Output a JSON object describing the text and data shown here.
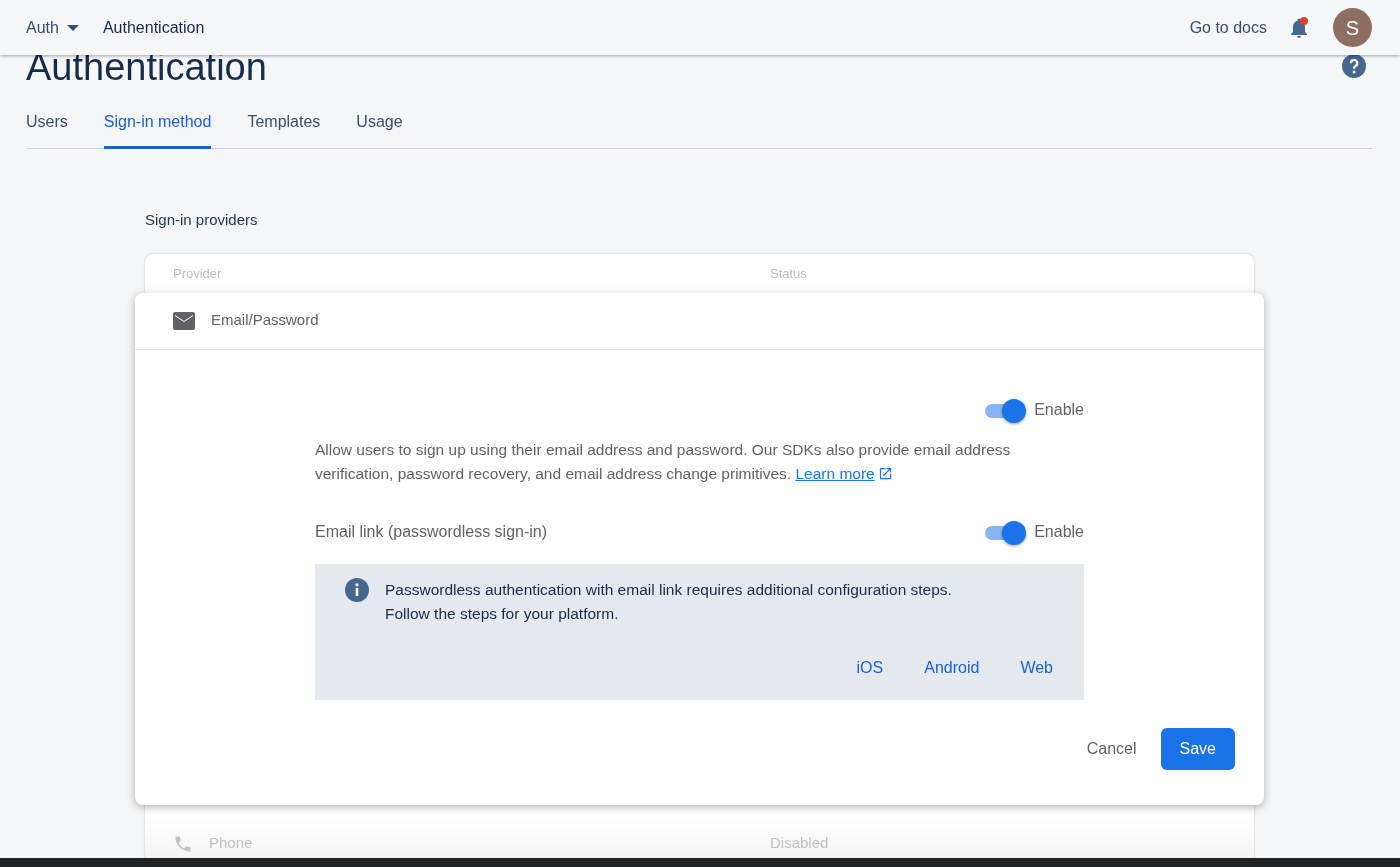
{
  "top_bar": {
    "product": "Auth",
    "page": "Authentication",
    "docs_link": "Go to docs",
    "notifications": {
      "unread": true
    },
    "avatar": "S"
  },
  "page_title": "Authentication",
  "tabs": [
    {
      "label": "Users",
      "selected": false
    },
    {
      "label": "Sign-in method",
      "selected": true
    },
    {
      "label": "Templates",
      "selected": false
    },
    {
      "label": "Usage",
      "selected": false
    }
  ],
  "section_title": "Sign-in providers",
  "table": {
    "columns": [
      "Provider",
      "Status"
    ],
    "expanded_provider": {
      "name": "Email/Password",
      "enable_toggle": {
        "on": true,
        "label": "Enable"
      },
      "description": "Allow users to sign up using their email address and password. Our SDKs also provide email address verification, password recovery, and email address change primitives.",
      "learn_more": "Learn more",
      "email_link": {
        "label": "Email link (passwordless sign-in)",
        "on": true,
        "toggle_label": "Enable"
      },
      "notice": {
        "lines": [
          "Passwordless authentication with email link requires additional configuration steps.",
          "Follow the steps for your platform."
        ],
        "platforms": [
          "iOS",
          "Android",
          "Web"
        ]
      },
      "cancel": "Cancel",
      "save": "Save"
    },
    "rows": [
      {
        "provider": "Phone",
        "status": "Disabled"
      }
    ]
  }
}
